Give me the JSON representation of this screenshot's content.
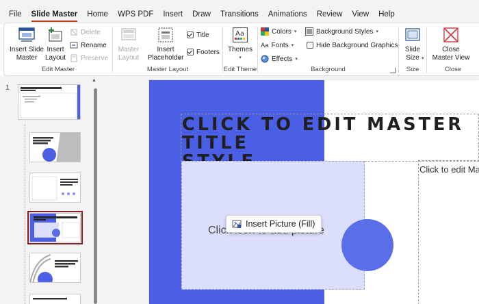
{
  "menu": {
    "tabs": [
      {
        "label": "File"
      },
      {
        "label": "Slide Master",
        "active": true
      },
      {
        "label": "Home"
      },
      {
        "label": "WPS PDF"
      },
      {
        "label": "Insert"
      },
      {
        "label": "Draw"
      },
      {
        "label": "Transitions"
      },
      {
        "label": "Animations"
      },
      {
        "label": "Review"
      },
      {
        "label": "View"
      },
      {
        "label": "Help"
      }
    ]
  },
  "ribbon": {
    "edit_master": {
      "label": "Edit Master",
      "insert_slide_master": "Insert Slide\nMaster",
      "insert_layout": "Insert\nLayout",
      "delete": "Delete",
      "rename": "Rename",
      "preserve": "Preserve"
    },
    "master_layout": {
      "label": "Master Layout",
      "master_layout_btn": "Master\nLayout",
      "insert_placeholder": "Insert\nPlaceholder",
      "title": "Title",
      "footers": "Footers",
      "title_checked": true,
      "footers_checked": true
    },
    "edit_theme": {
      "label": "Edit Theme",
      "themes": "Themes"
    },
    "background": {
      "label": "Background",
      "colors": "Colors",
      "fonts": "Fonts",
      "effects": "Effects",
      "background_styles": "Background Styles",
      "hide_background_graphics": "Hide Background Graphics",
      "hide_checked": false
    },
    "size": {
      "label": "Size",
      "slide_size": "Slide\nSize"
    },
    "close": {
      "label": "Close",
      "close_master_view": "Close\nMaster View"
    }
  },
  "thumbnails": {
    "first_number": "1"
  },
  "slide": {
    "title_text": "CLICK TO EDIT MASTER TITLE\nSTYLE",
    "picture_placeholder_text": "Click icon to add picture",
    "body_text": "Click to edit Master text styles",
    "tooltip": "Insert Picture (Fill)",
    "colors": {
      "accent_blue": "#4b5fe6",
      "circle_blue": "#5b6ee9",
      "picture_fill": "#dcdffb",
      "active_tab_underline": "#c43e1c",
      "selected_thumb_border": "#8a1c25"
    }
  }
}
